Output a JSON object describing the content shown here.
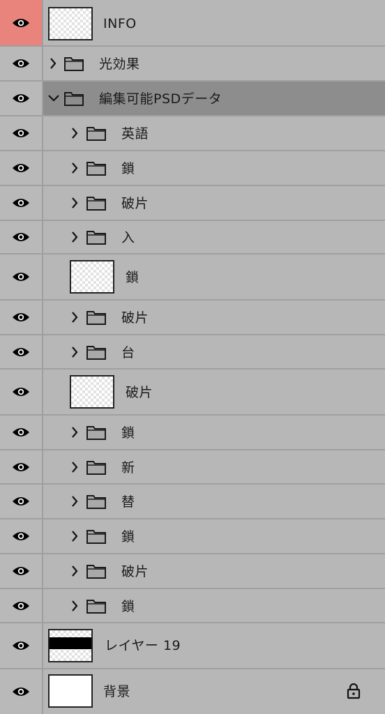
{
  "layers": [
    {
      "label": "INFO",
      "type": "thumb",
      "eye_style": "red"
    },
    {
      "label": "光効果",
      "type": "group",
      "expanded": false
    },
    {
      "label": "編集可能PSDデータ",
      "type": "group",
      "expanded": true,
      "selected": true
    },
    {
      "label": "英語",
      "type": "group",
      "expanded": false
    },
    {
      "label": "鎖",
      "type": "group",
      "expanded": false
    },
    {
      "label": "破片",
      "type": "group",
      "expanded": false
    },
    {
      "label": "入",
      "type": "group",
      "expanded": false
    },
    {
      "label": "鎖",
      "type": "thumb"
    },
    {
      "label": "破片",
      "type": "group",
      "expanded": false
    },
    {
      "label": "台",
      "type": "group",
      "expanded": false
    },
    {
      "label": "破片",
      "type": "thumb"
    },
    {
      "label": "鎖",
      "type": "group",
      "expanded": false
    },
    {
      "label": "新",
      "type": "group",
      "expanded": false
    },
    {
      "label": "替",
      "type": "group",
      "expanded": false
    },
    {
      "label": "鎖",
      "type": "group",
      "expanded": false
    },
    {
      "label": "破片",
      "type": "group",
      "expanded": false
    },
    {
      "label": "鎖",
      "type": "group",
      "expanded": false
    },
    {
      "label": "レイヤー 19",
      "type": "thumb-bar"
    },
    {
      "label": "背景",
      "type": "thumb-white",
      "locked": true
    }
  ],
  "icons": {
    "visibility": "eye-icon",
    "expand": "chevron-icon",
    "group": "folder-icon",
    "lock": "lock-icon"
  },
  "colors": {
    "panel_bg": "#b7b7b7",
    "selected_row": "#8d8d8d",
    "highlight_eye": "#e8847b"
  }
}
